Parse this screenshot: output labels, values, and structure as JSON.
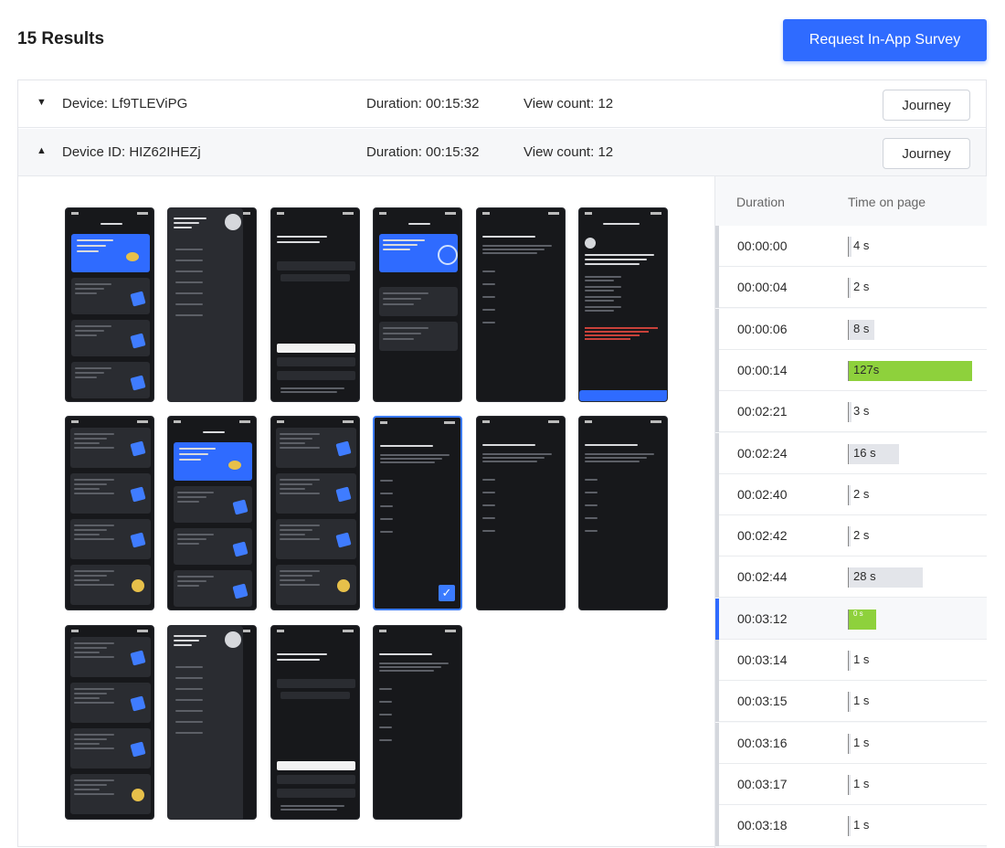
{
  "header": {
    "results_label": "15 Results",
    "survey_button": "Request In-App Survey"
  },
  "devices": [
    {
      "label": "Device: Lf9TLEViPG",
      "duration": "Duration: 00:15:32",
      "views": "View count: 12",
      "journey": "Journey",
      "caret": "▼"
    },
    {
      "label": "Device ID: HIZ62IHEZj",
      "duration": "Duration: 00:15:32",
      "views": "View count: 12",
      "journey": "Journey",
      "caret": "▲"
    }
  ],
  "timeline": {
    "col_duration": "Duration",
    "col_time_on_page": "Time on page",
    "rows": [
      {
        "time": "00:00:00",
        "secs": "4 s",
        "fraction": 0.02,
        "color": "#e3e5ea"
      },
      {
        "time": "00:00:04",
        "secs": "2 s",
        "fraction": 0.01,
        "color": "#e3e5ea"
      },
      {
        "time": "00:00:06",
        "secs": "8 s",
        "fraction": 0.21,
        "color": "#e3e5ea"
      },
      {
        "time": "00:00:14",
        "secs": "127s",
        "fraction": 1.0,
        "color": "#8ed13c"
      },
      {
        "time": "00:02:21",
        "secs": "3 s",
        "fraction": 0.02,
        "color": "#e3e5ea"
      },
      {
        "time": "00:02:24",
        "secs": "16 s",
        "fraction": 0.41,
        "color": "#e3e5ea"
      },
      {
        "time": "00:02:40",
        "secs": "2 s",
        "fraction": 0.01,
        "color": "#e3e5ea"
      },
      {
        "time": "00:02:42",
        "secs": "2 s",
        "fraction": 0.01,
        "color": "#e3e5ea"
      },
      {
        "time": "00:02:44",
        "secs": "28 s",
        "fraction": 0.6,
        "color": "#e3e5ea"
      },
      {
        "time": "00:03:12",
        "secs": "0 s",
        "fraction": 0.22,
        "color": "#8ed13c",
        "active": true
      },
      {
        "time": "00:03:14",
        "secs": "1 s",
        "fraction": 0.01,
        "color": "#e3e5ea"
      },
      {
        "time": "00:03:15",
        "secs": "1 s",
        "fraction": 0.01,
        "color": "#e3e5ea"
      },
      {
        "time": "00:03:16",
        "secs": "1 s",
        "fraction": 0.01,
        "color": "#e3e5ea"
      },
      {
        "time": "00:03:17",
        "secs": "1 s",
        "fraction": 0.01,
        "color": "#e3e5ea"
      },
      {
        "time": "00:03:18",
        "secs": "1 s",
        "fraction": 0.01,
        "color": "#e3e5ea"
      }
    ]
  },
  "gallery": {
    "screens": [
      {
        "kind": "home"
      },
      {
        "kind": "menu"
      },
      {
        "kind": "email"
      },
      {
        "kind": "progress"
      },
      {
        "kind": "privacy"
      },
      {
        "kind": "video"
      },
      {
        "kind": "cards"
      },
      {
        "kind": "home2"
      },
      {
        "kind": "cards"
      },
      {
        "kind": "privacy",
        "selected": true
      },
      {
        "kind": "privacy"
      },
      {
        "kind": "privacy"
      },
      {
        "kind": "cards"
      },
      {
        "kind": "menu"
      },
      {
        "kind": "email"
      },
      {
        "kind": "privacy"
      }
    ]
  }
}
